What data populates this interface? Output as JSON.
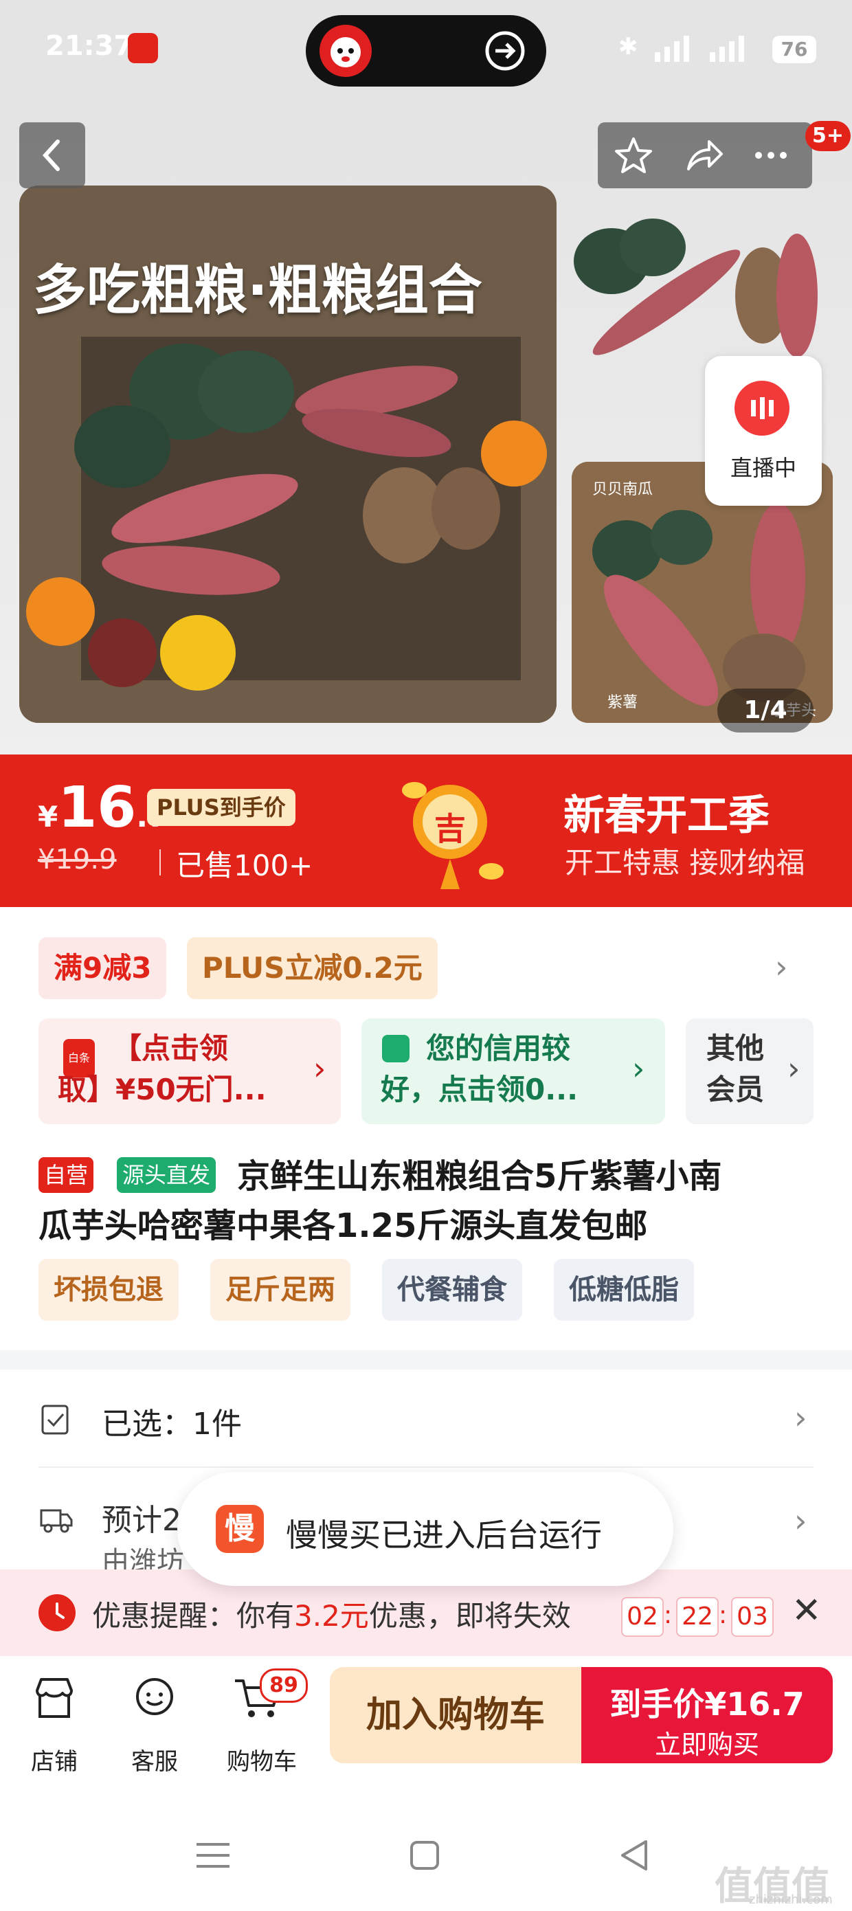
{
  "status_bar": {
    "time": "21:37",
    "signal": "5G",
    "battery": "76"
  },
  "gallery": {
    "main_image_text": "多吃粗粮·粗粮组合",
    "side_label_1": "贝贝南瓜",
    "side_label_2": "紫薯",
    "side_label_3": "小芋头",
    "counter": "1/4",
    "live_label": "直播中",
    "more_badge": "5+"
  },
  "price": {
    "currency": "¥",
    "integer": "16",
    "decimal": ".7",
    "plus_tag": "PLUS到手价",
    "original": "¥19.9",
    "sold": "已售100+",
    "lantern_char": "吉",
    "promo_title": "新春开工季",
    "promo_sub": "开工特惠 接财纳福"
  },
  "promos": {
    "chip1": "满9减3",
    "chip2": "PLUS立减0.2元",
    "coupon1_line1": "【点击领",
    "coupon1_line2": "取】¥50无门...",
    "coupon1_icon": "白条",
    "coupon2_line1": "您的信用较",
    "coupon2_line2": "好，点击领0...",
    "coupon3_line1": "其他",
    "coupon3_line2": "会员"
  },
  "product": {
    "tag_self": "自营",
    "tag_source": "源头直发",
    "title_line1": "京鲜生山东粗粮组合5斤紫薯小南",
    "title_line2": "瓜芋头哈密薯中果各1.25斤源头直发包邮",
    "features": [
      "坏损包退",
      "足斤足两",
      "代餐辅食",
      "低糖低脂"
    ]
  },
  "rows": {
    "selected": "已选：1件",
    "estimate": "预计2",
    "estimate_sub": "由潍坊"
  },
  "toast": {
    "icon_char": "慢",
    "text": "慢慢买已进入后台运行"
  },
  "reminder": {
    "prefix": "优惠提醒：你有",
    "amount": "3.2元",
    "suffix": "优惠，即将失效",
    "hh": "02",
    "mm": "22",
    "ss": "03"
  },
  "bottom_bar": {
    "shop": "店铺",
    "service": "客服",
    "cart": "购物车",
    "cart_count": "89",
    "add_to_cart": "加入购物车",
    "buy_price_label": "到手价¥16.7",
    "buy_now": "立即购买"
  },
  "watermark": {
    "main": "值值值",
    "sub": "zhizhizhi.com"
  },
  "colors": {
    "brand_red": "#e2231a",
    "buy_red": "#e8173a",
    "add_cart_bg": "#fde7c8"
  }
}
